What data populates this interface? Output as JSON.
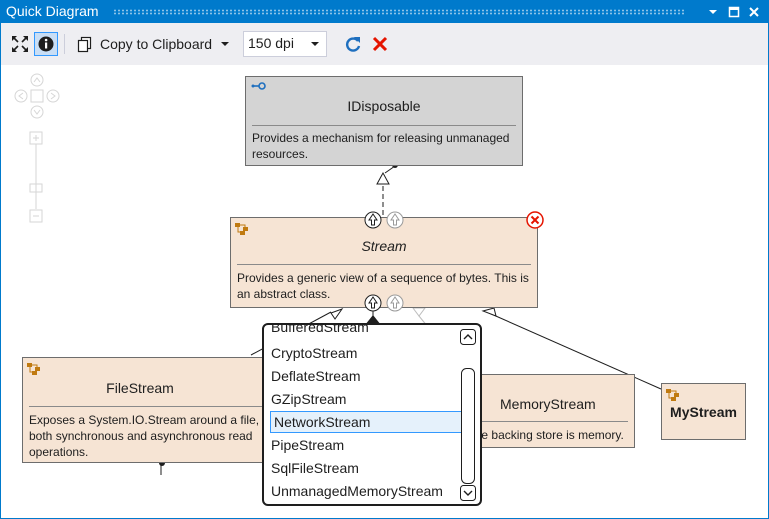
{
  "window": {
    "title": "Quick Diagram"
  },
  "toolbar": {
    "copy_label": "Copy to Clipboard",
    "dpi_value": "150 dpi"
  },
  "diagram": {
    "idisposable": {
      "name": "IDisposable",
      "description_lines": [
        "Provides a mechanism for releasing unmanaged",
        "resources."
      ]
    },
    "stream": {
      "name": "Stream",
      "description_lines": [
        "Provides a generic view of a sequence of bytes. This is",
        "an abstract class."
      ]
    },
    "filestream": {
      "name": "FileStream",
      "description_lines": [
        "Exposes a System.IO.Stream around a file, s",
        "both synchronous and asynchronous read",
        "operations."
      ]
    },
    "memorystream": {
      "name": "MemoryStream",
      "description": "Creates a stream whose backing store is memory."
    },
    "mystream": {
      "name": "MyStream"
    }
  },
  "popup": {
    "items": [
      "BufferedStream",
      "CryptoStream",
      "DeflateStream",
      "GZipStream",
      "NetworkStream",
      "PipeStream",
      "SqlFileStream",
      "UnmanagedMemoryStream"
    ],
    "selected": "NetworkStream"
  },
  "colors": {
    "accent": "#007acc",
    "class_fill": "#f6e4d4",
    "interface_fill": "#d4d4d4",
    "close_red": "#e51400",
    "refresh_blue": "#1e6fbf"
  }
}
